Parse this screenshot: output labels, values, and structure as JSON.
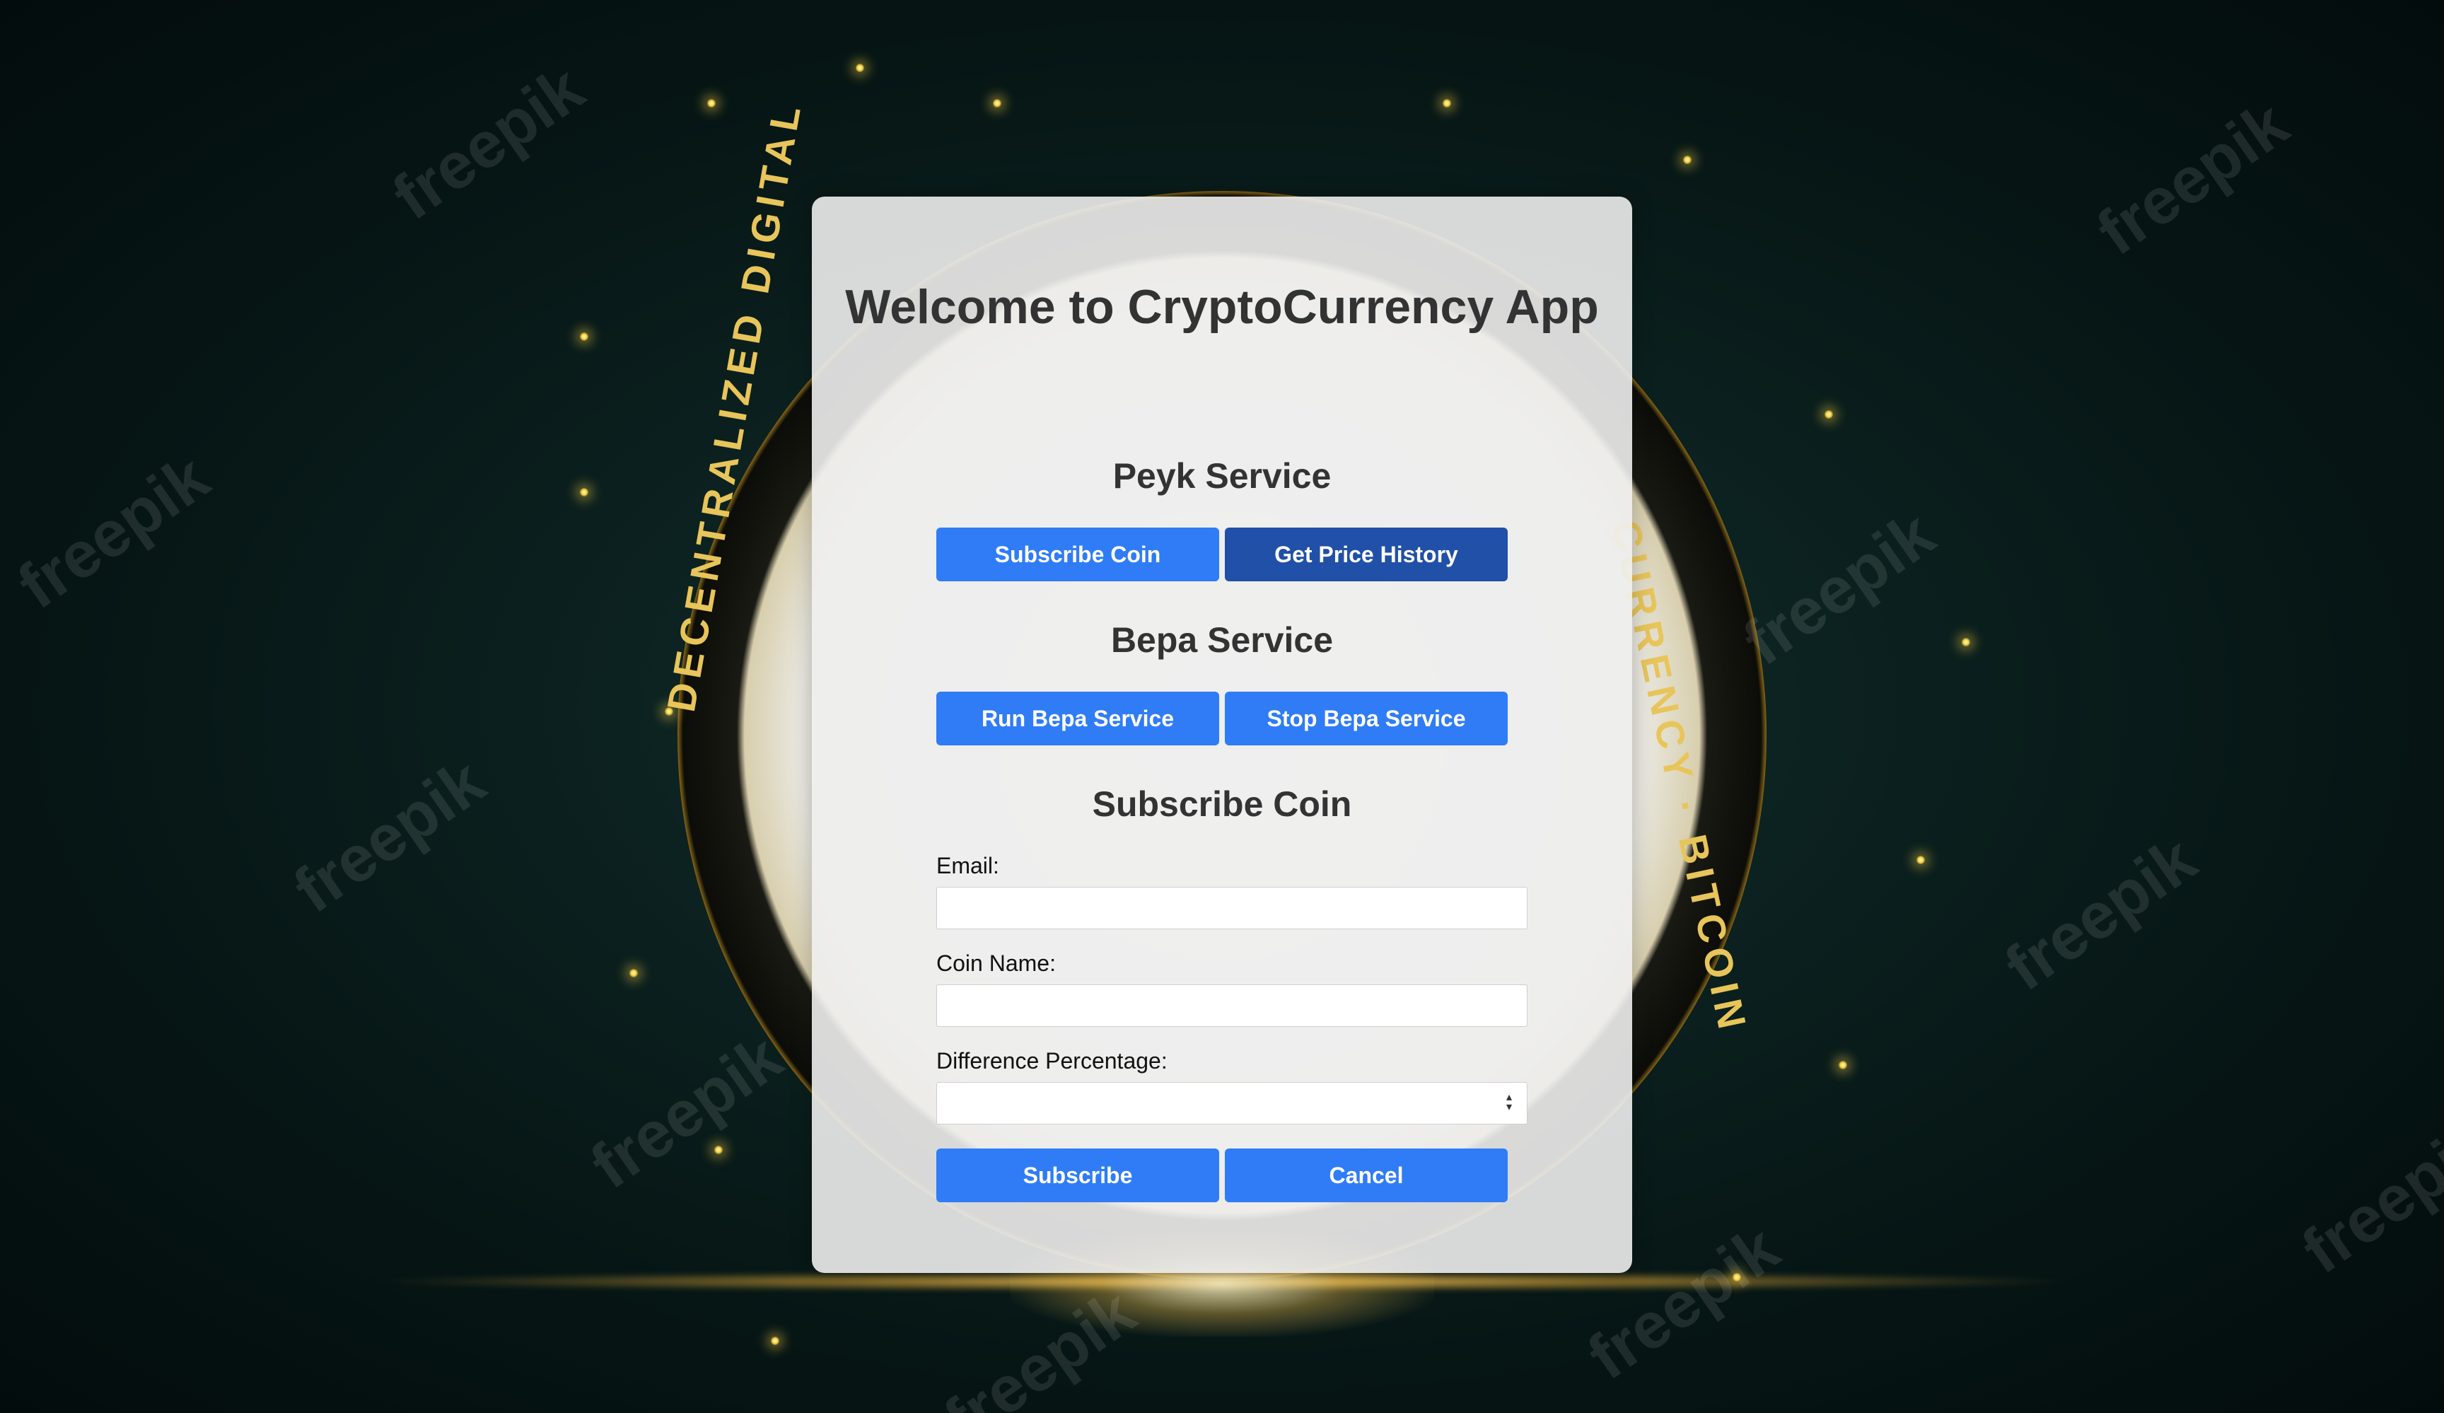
{
  "app": {
    "title": "Welcome to CryptoCurrency App"
  },
  "background": {
    "coin_text_left": "DECENTRALIZED DIGITAL",
    "coin_text_right": "CURRENCY · BITCOIN",
    "watermark": "freepik"
  },
  "peyk": {
    "heading": "Peyk Service",
    "subscribe_label": "Subscribe Coin",
    "price_history_label": "Get Price History"
  },
  "bepa": {
    "heading": "Bepa Service",
    "run_label": "Run Bepa Service",
    "stop_label": "Stop Bepa Service"
  },
  "subscribe_form": {
    "heading": "Subscribe Coin",
    "email_label": "Email:",
    "email_value": "",
    "coin_label": "Coin Name:",
    "coin_value": "",
    "diff_label": "Difference Percentage:",
    "diff_value": "",
    "submit_label": "Subscribe",
    "cancel_label": "Cancel"
  },
  "colors": {
    "primary_button": "#2f7cf6",
    "active_button": "#2050a8",
    "panel": "#eeeeee",
    "heading_text": "#333333"
  },
  "icons": {
    "spinner": "number-spinner-icon"
  }
}
